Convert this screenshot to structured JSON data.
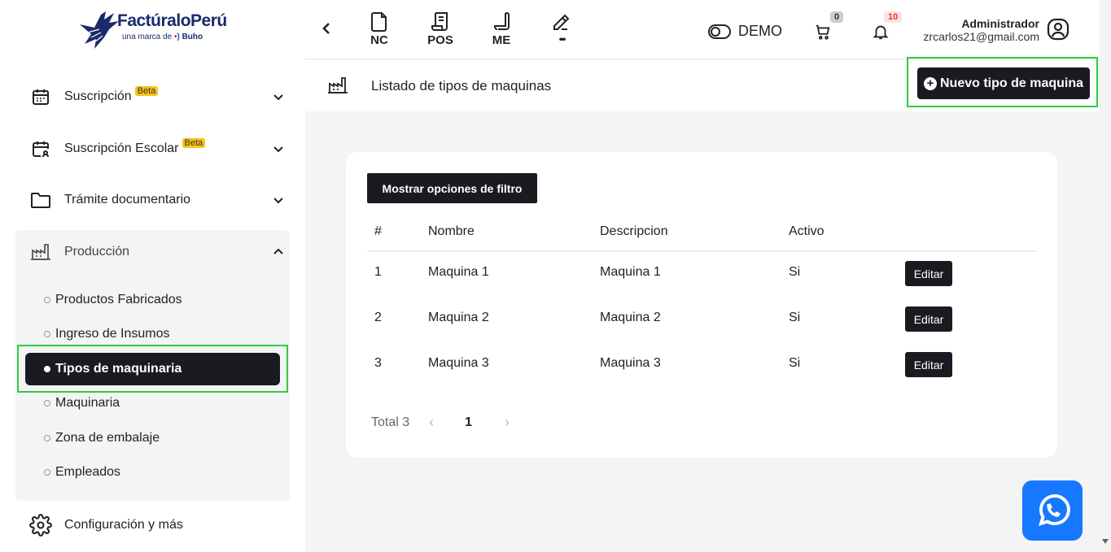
{
  "logo": {
    "brand": "FactúraloPerú",
    "sub_prefix": "una marca de",
    "sub_brand": "Buho"
  },
  "sidebar": {
    "items": [
      {
        "label": "Suscripción",
        "badge": "Beta",
        "icon": "calendar-icon"
      },
      {
        "label": "Suscripción Escolar",
        "badge": "Beta",
        "icon": "calendar-user-icon"
      },
      {
        "label": "Trámite documentario",
        "icon": "folder-icon"
      },
      {
        "label": "Producción",
        "icon": "factory-icon"
      },
      {
        "label": "Configuración y más",
        "icon": "gear-icon"
      }
    ],
    "production_sub": [
      {
        "label": "Productos Fabricados"
      },
      {
        "label": "Ingreso de Insumos"
      },
      {
        "label": "Tipos de maquinaria"
      },
      {
        "label": "Maquinaria"
      },
      {
        "label": "Zona de embalaje"
      },
      {
        "label": "Empleados"
      }
    ]
  },
  "topbar": {
    "tools": [
      {
        "label": "NC",
        "icon": "document-icon"
      },
      {
        "label": "POS",
        "icon": "receipt-icon"
      },
      {
        "label": "ME",
        "icon": "scroll-icon"
      },
      {
        "label": "•••",
        "icon": "pencil-icon"
      }
    ],
    "demo_label": "DEMO",
    "cart_count": "0",
    "notification_count": "10",
    "user_name": "Administrador",
    "user_email": "zrcarlos21@gmail.com"
  },
  "page": {
    "title": "Listado de tipos de maquinas",
    "new_button": "Nuevo tipo de maquina",
    "filter_button": "Mostrar opciones de filtro"
  },
  "table": {
    "headers": [
      "#",
      "Nombre",
      "Descripcion",
      "Activo"
    ],
    "rows": [
      {
        "num": "1",
        "name": "Maquina 1",
        "desc": "Maquina 1",
        "active": "Si",
        "action": "Editar"
      },
      {
        "num": "2",
        "name": "Maquina 2",
        "desc": "Maquina 2",
        "active": "Si",
        "action": "Editar"
      },
      {
        "num": "3",
        "name": "Maquina 3",
        "desc": "Maquina 3",
        "active": "Si",
        "action": "Editar"
      }
    ]
  },
  "pagination": {
    "total_label": "Total 3",
    "prev": "‹",
    "current": "1",
    "next": "›"
  },
  "colors": {
    "dark": "#1a1a21",
    "highlight": "#2ecc40",
    "beta": "#f5c518",
    "whatsapp": "#1677ff"
  }
}
